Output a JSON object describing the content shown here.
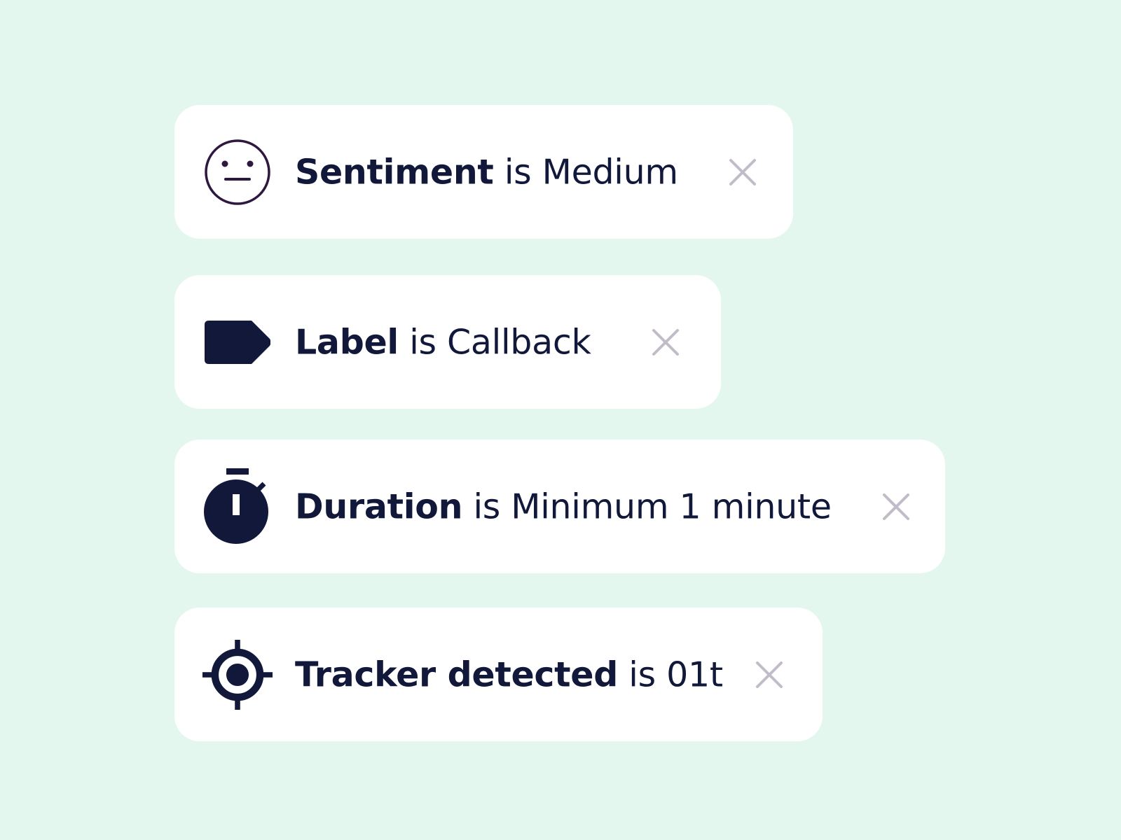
{
  "colors": {
    "background": "#e3f7ee",
    "chip": "#ffffff",
    "text": "#11183a",
    "close": "#c2bcc9",
    "sentiment_icon": "#2e1840"
  },
  "filters": [
    {
      "field": "Sentiment",
      "operator": "is",
      "value": "Medium",
      "icon": "neutral-face-icon"
    },
    {
      "field": "Label",
      "operator": "is",
      "value": "Callback",
      "icon": "tag-icon"
    },
    {
      "field": "Duration",
      "operator": "is",
      "value": "Minimum 1 minute",
      "icon": "stopwatch-icon"
    },
    {
      "field": "Tracker detected",
      "operator": "is",
      "value": "01t",
      "icon": "crosshair-icon"
    }
  ]
}
